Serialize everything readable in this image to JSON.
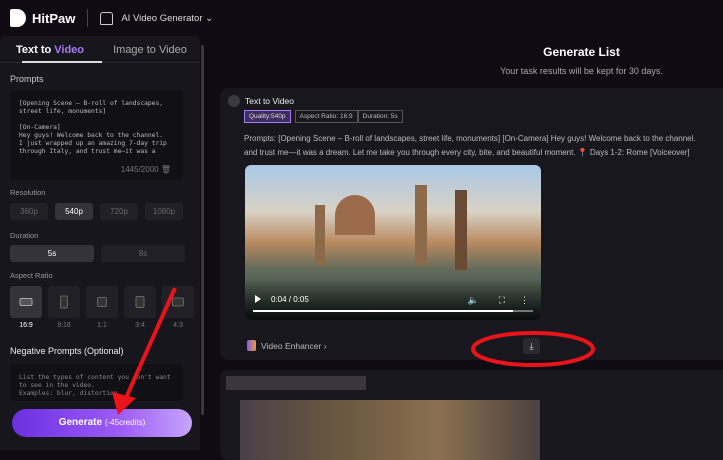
{
  "header": {
    "brand": "HitPaw",
    "product": "AI Video Generator"
  },
  "tabs": [
    {
      "label_a": "Text to ",
      "label_b": "Video"
    },
    {
      "label": "Image to Video"
    }
  ],
  "prompts": {
    "label": "Prompts",
    "value": "[Opening Scene – B-roll of landscapes,\nstreet life, monuments]\n\n[On-Camera]\nHey guys! Welcome back to the channel.\nI just wrapped up an amazing 7-day trip\nthrough Italy, and trust me—it was a",
    "count": "1445/2000"
  },
  "resolution": {
    "label": "Resolution",
    "options": [
      "360p",
      "540p",
      "720p",
      "1080p"
    ],
    "selected": "540p"
  },
  "duration": {
    "label": "Duration",
    "options": [
      "5s",
      "8s"
    ],
    "selected": "5s"
  },
  "aspect": {
    "label": "Aspect Ratio",
    "options": [
      "16:9",
      "9:16",
      "1:1",
      "3:4",
      "4:3"
    ],
    "selected": "16:9"
  },
  "negative": {
    "label": "Negative Prompts (Optional)",
    "placeholder": "List the types of content you don't want\nto see in the video.\nExamples: blur, distortion,"
  },
  "generate": {
    "label": "Generate",
    "credits": "(-45credits)"
  },
  "list": {
    "title": "Generate List",
    "subtitle": "Your task results will be kept for 30 days."
  },
  "task": {
    "type": "Text to Video",
    "tags": [
      "Quality:540p",
      "Aspect Ratio: 16:9",
      "Duration: 5s"
    ],
    "prompt_line1": "Prompts:  [Opening Scene – B-roll of landscapes, street life, monuments] [On-Camera] Hey guys! Welcome back to the channel.",
    "prompt_line2": "and trust me—it was a dream. Let me take you through every city, bite, and beautiful moment. 📍 Days 1-2: Rome [Voiceover]",
    "time": "0:04 / 0:05",
    "progress": 0.93,
    "enhancer": "Video Enhancer ›"
  }
}
